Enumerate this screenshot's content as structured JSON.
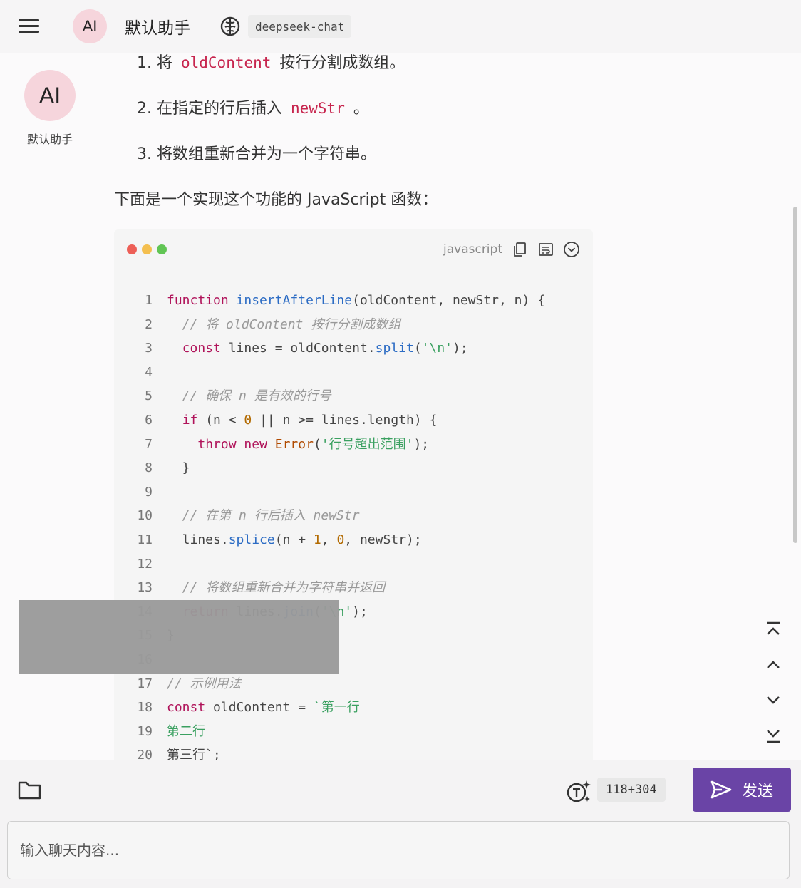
{
  "header": {
    "avatar_text": "AI",
    "assistant_name": "默认助手",
    "model_name": "deepseek-chat"
  },
  "sidebar_avatar": {
    "text": "AI",
    "name": "默认助手"
  },
  "message": {
    "step1_prefix": "1. 将",
    "step1_code": "oldContent",
    "step1_suffix": "按行分割成数组。",
    "step2_prefix": "2. 在指定的行后插入",
    "step2_code": "newStr",
    "step2_suffix": "。",
    "step3": "3. 将数组重新合并为一个字符串。",
    "intro": "下面是一个实现这个功能的 JavaScript 函数："
  },
  "codeblock": {
    "language": "javascript",
    "colors": {
      "red": "#ed5f57",
      "yellow": "#f4bf4f",
      "green": "#61c554"
    },
    "lines": [
      {
        "n": "1",
        "tokens": [
          [
            "function",
            "kw"
          ],
          [
            " ",
            ""
          ],
          [
            "insertAfterLine",
            "fn"
          ],
          [
            "(oldContent, newStr, n) {",
            ""
          ]
        ]
      },
      {
        "n": "2",
        "tokens": [
          [
            "  // 将 oldContent 按行分割成数组",
            "cm"
          ]
        ]
      },
      {
        "n": "3",
        "tokens": [
          [
            "  ",
            ""
          ],
          [
            "const",
            "kw"
          ],
          [
            " lines = oldContent.",
            ""
          ],
          [
            "split",
            "fn"
          ],
          [
            "(",
            ""
          ],
          [
            "'\\n'",
            "str"
          ],
          [
            ");",
            ""
          ]
        ]
      },
      {
        "n": "4",
        "tokens": []
      },
      {
        "n": "5",
        "tokens": [
          [
            "  // 确保 n 是有效的行号",
            "cm"
          ]
        ]
      },
      {
        "n": "6",
        "tokens": [
          [
            "  ",
            ""
          ],
          [
            "if",
            "kw"
          ],
          [
            " (n < ",
            ""
          ],
          [
            "0",
            "num"
          ],
          [
            " || n >= lines.length) {",
            ""
          ]
        ]
      },
      {
        "n": "7",
        "tokens": [
          [
            "    ",
            ""
          ],
          [
            "throw",
            "kw"
          ],
          [
            " ",
            ""
          ],
          [
            "new",
            "kw"
          ],
          [
            " ",
            ""
          ],
          [
            "Error",
            "cls"
          ],
          [
            "(",
            ""
          ],
          [
            "'行号超出范围'",
            "str"
          ],
          [
            ");",
            ""
          ]
        ]
      },
      {
        "n": "8",
        "tokens": [
          [
            "  }",
            ""
          ]
        ]
      },
      {
        "n": "9",
        "tokens": []
      },
      {
        "n": "10",
        "tokens": [
          [
            "  // 在第 n 行后插入 newStr",
            "cm"
          ]
        ]
      },
      {
        "n": "11",
        "tokens": [
          [
            "  lines.",
            ""
          ],
          [
            "splice",
            "fn"
          ],
          [
            "(n + ",
            ""
          ],
          [
            "1",
            "num"
          ],
          [
            ", ",
            ""
          ],
          [
            "0",
            "num"
          ],
          [
            ", newStr);",
            ""
          ]
        ]
      },
      {
        "n": "12",
        "tokens": []
      },
      {
        "n": "13",
        "tokens": [
          [
            "  // 将数组重新合并为字符串并返回",
            "cm"
          ]
        ]
      },
      {
        "n": "14",
        "tokens": [
          [
            "  ",
            ""
          ],
          [
            "return",
            "kw"
          ],
          [
            " lines.",
            ""
          ],
          [
            "join",
            "fn"
          ],
          [
            "(",
            ""
          ],
          [
            "'\\n'",
            "str"
          ],
          [
            ");",
            ""
          ]
        ]
      },
      {
        "n": "15",
        "tokens": [
          [
            "}",
            ""
          ]
        ]
      },
      {
        "n": "16",
        "tokens": []
      },
      {
        "n": "17",
        "tokens": [
          [
            "// 示例用法",
            "cm"
          ]
        ]
      },
      {
        "n": "18",
        "tokens": [
          [
            "const",
            "kw"
          ],
          [
            " oldContent = ",
            ""
          ],
          [
            "`第一行",
            "str"
          ]
        ]
      },
      {
        "n": "19",
        "tokens": [
          [
            "第二行",
            "str"
          ]
        ]
      },
      {
        "n": "20",
        "tokens": [
          [
            "第三行`",
            ""
          ],
          [
            ";",
            ""
          ]
        ]
      }
    ]
  },
  "composer": {
    "token_count": "118+304",
    "send_label": "发送",
    "placeholder": "输入聊天内容..."
  }
}
